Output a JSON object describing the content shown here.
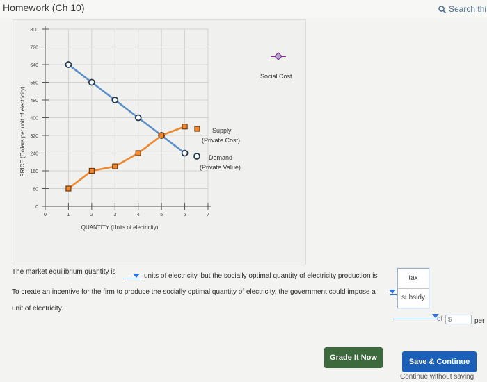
{
  "header": {
    "title": "Homework (Ch 10)",
    "search_label": "Search thi"
  },
  "chart_data": {
    "type": "line",
    "title": "",
    "xlabel": "QUANTITY (Units of electricity)",
    "ylabel": "PRICE (Dollars per unit of electricity)",
    "xlim": [
      0,
      7
    ],
    "ylim": [
      0,
      800
    ],
    "xticks": [
      "0",
      "1",
      "2",
      "3",
      "4",
      "5",
      "6",
      "7"
    ],
    "yticks": [
      "0",
      "80",
      "160",
      "240",
      "320",
      "400",
      "480",
      "560",
      "640",
      "720",
      "800"
    ],
    "series": [
      {
        "name": "Demand (Private Value)",
        "label_line1": "Demand",
        "label_line2": "(Private Value)",
        "color": "#5b8fc9",
        "marker": "circle",
        "x": [
          1,
          2,
          3,
          4,
          5,
          6
        ],
        "y": [
          640,
          560,
          480,
          400,
          320,
          240
        ]
      },
      {
        "name": "Supply (Private Cost)",
        "label_line1": "Supply",
        "label_line2": "(Private Cost)",
        "color": "#f0872d",
        "marker": "square",
        "x": [
          1,
          2,
          3,
          4,
          5,
          6
        ],
        "y": [
          80,
          160,
          180,
          240,
          320,
          360
        ]
      }
    ],
    "legend": {
      "social_cost_label": "Social Cost",
      "social_cost_color": "#7d3a8c"
    }
  },
  "question": {
    "q1_before": "The market equilibrium quantity is",
    "q1_after": "units of electricity, but the socially optimal quantity of electricity production is",
    "q2_line1": "To create an incentive for the firm to produce the socially optimal quantity of electricity, the government could impose a",
    "q2_line2": "unit of electricity.",
    "of_label": "of",
    "per_label": "per",
    "currency_placeholder": "$",
    "dropdown_options": [
      "tax",
      "subsidy"
    ]
  },
  "buttons": {
    "grade": "Grade It Now",
    "save": "Save & Continue",
    "continue": "Continue without saving"
  }
}
